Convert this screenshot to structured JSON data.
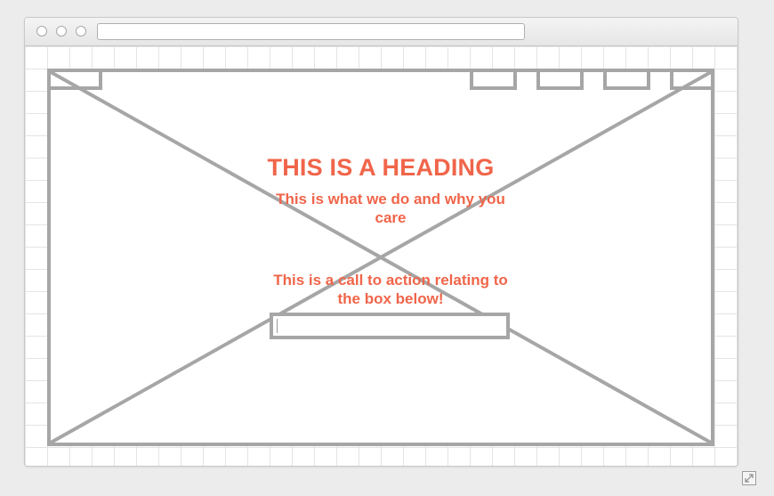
{
  "browser": {
    "buttons": [
      "close",
      "minimize",
      "zoom"
    ],
    "url": ""
  },
  "hero": {
    "heading": "THIS IS A HEADING",
    "subheading": "This is what we do and why you care",
    "cta": "This is a call to action relating to the box below!",
    "input_value": ""
  },
  "nav": {
    "tab_count_right": 4,
    "logo_placeholder": true
  },
  "colors": {
    "accent": "#f0654a",
    "wireframe": "#a6a6a6",
    "grid": "#e4e4e4",
    "background": "#ececec"
  },
  "icons": {
    "expand": "expand-icon"
  }
}
